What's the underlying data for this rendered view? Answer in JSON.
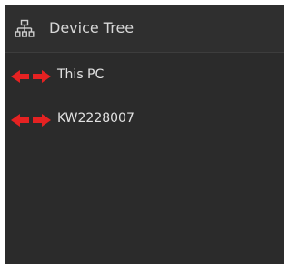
{
  "header": {
    "icon": "device-tree-icon",
    "title": "Device Tree"
  },
  "tree": {
    "items": [
      {
        "label": "This PC",
        "icon": "connection-arrows-icon"
      },
      {
        "label": "KW2228007",
        "icon": "connection-arrows-icon"
      }
    ]
  },
  "colors": {
    "panel_background": "#2b2b2b",
    "text": "#e2e2e2",
    "icon_accent": "#e52222"
  }
}
